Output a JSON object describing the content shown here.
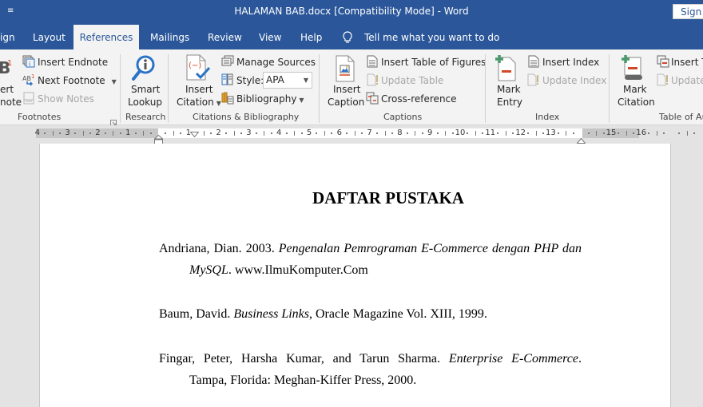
{
  "titlebar": {
    "title": "HALAMAN BAB.docx [Compatibility Mode]  -  Word",
    "signin_label": "Sign in",
    "qat_icon": "customize-quick-access-arrow"
  },
  "tabs": [
    {
      "label": "ign",
      "active": false
    },
    {
      "label": "Layout",
      "active": false
    },
    {
      "label": "References",
      "active": true
    },
    {
      "label": "Mailings",
      "active": false
    },
    {
      "label": "Review",
      "active": false
    },
    {
      "label": "View",
      "active": false
    },
    {
      "label": "Help",
      "active": false
    }
  ],
  "tellme": {
    "label": "Tell me what you want to do",
    "icon": "lightbulb-icon"
  },
  "ribbon": {
    "footnotes": {
      "group_label": "Footnotes",
      "insert_footnote_partial_1": "ert",
      "insert_footnote_partial_2": "note",
      "insert_endnote": "Insert Endnote",
      "next_footnote": "Next Footnote",
      "show_notes": "Show Notes"
    },
    "research": {
      "group_label": "Research",
      "smart_lookup_1": "Smart",
      "smart_lookup_2": "Lookup"
    },
    "citations": {
      "group_label": "Citations & Bibliography",
      "insert_citation_1": "Insert",
      "insert_citation_2": "Citation",
      "manage_sources": "Manage Sources",
      "style_label": "Style:",
      "style_value": "APA",
      "bibliography": "Bibliography"
    },
    "captions": {
      "group_label": "Captions",
      "insert_caption_1": "Insert",
      "insert_caption_2": "Caption",
      "insert_table_of_figures": "Insert Table of Figures",
      "update_table": "Update Table",
      "cross_reference": "Cross-reference"
    },
    "index": {
      "group_label": "Index",
      "mark_entry_1": "Mark",
      "mark_entry_2": "Entry",
      "insert_index": "Insert Index",
      "update_index": "Update Index"
    },
    "toa": {
      "group_label": "Table of Au",
      "mark_citation_1": "Mark",
      "mark_citation_2": "Citation",
      "insert_toa": "Insert Ta",
      "update_toa": "Update"
    }
  },
  "ruler": {
    "left_numbers": [
      "4",
      "3",
      "2",
      "1"
    ],
    "right_numbers": [
      "1",
      "2",
      "3",
      "4",
      "5",
      "6",
      "7",
      "8",
      "9",
      "10",
      "11",
      "12",
      "13",
      "14",
      "15",
      "16"
    ]
  },
  "document": {
    "heading": "DAFTAR PUSTAKA",
    "references": [
      {
        "line1_plain": "Andriana, Dian. 2003. ",
        "line1_italic": "Pengenalan Pemrograman E-Commerce dengan PHP dan",
        "line2_italic": "MySQL",
        "line2_plain": ". www.IlmuKomputer.Com"
      },
      {
        "plain1": "Baum, David. ",
        "italic": "Business Links",
        "plain2": ", Oracle Magazine Vol. XIII, 1999."
      },
      {
        "line1_plain": "Fingar, Peter, Harsha Kumar, and Tarun Sharma. ",
        "line1_italic": "Enterprise E-Commerce",
        "line1_end": ".",
        "line2_plain": "Tampa, Florida: Meghan-Kiffer Press, 2000."
      }
    ]
  }
}
